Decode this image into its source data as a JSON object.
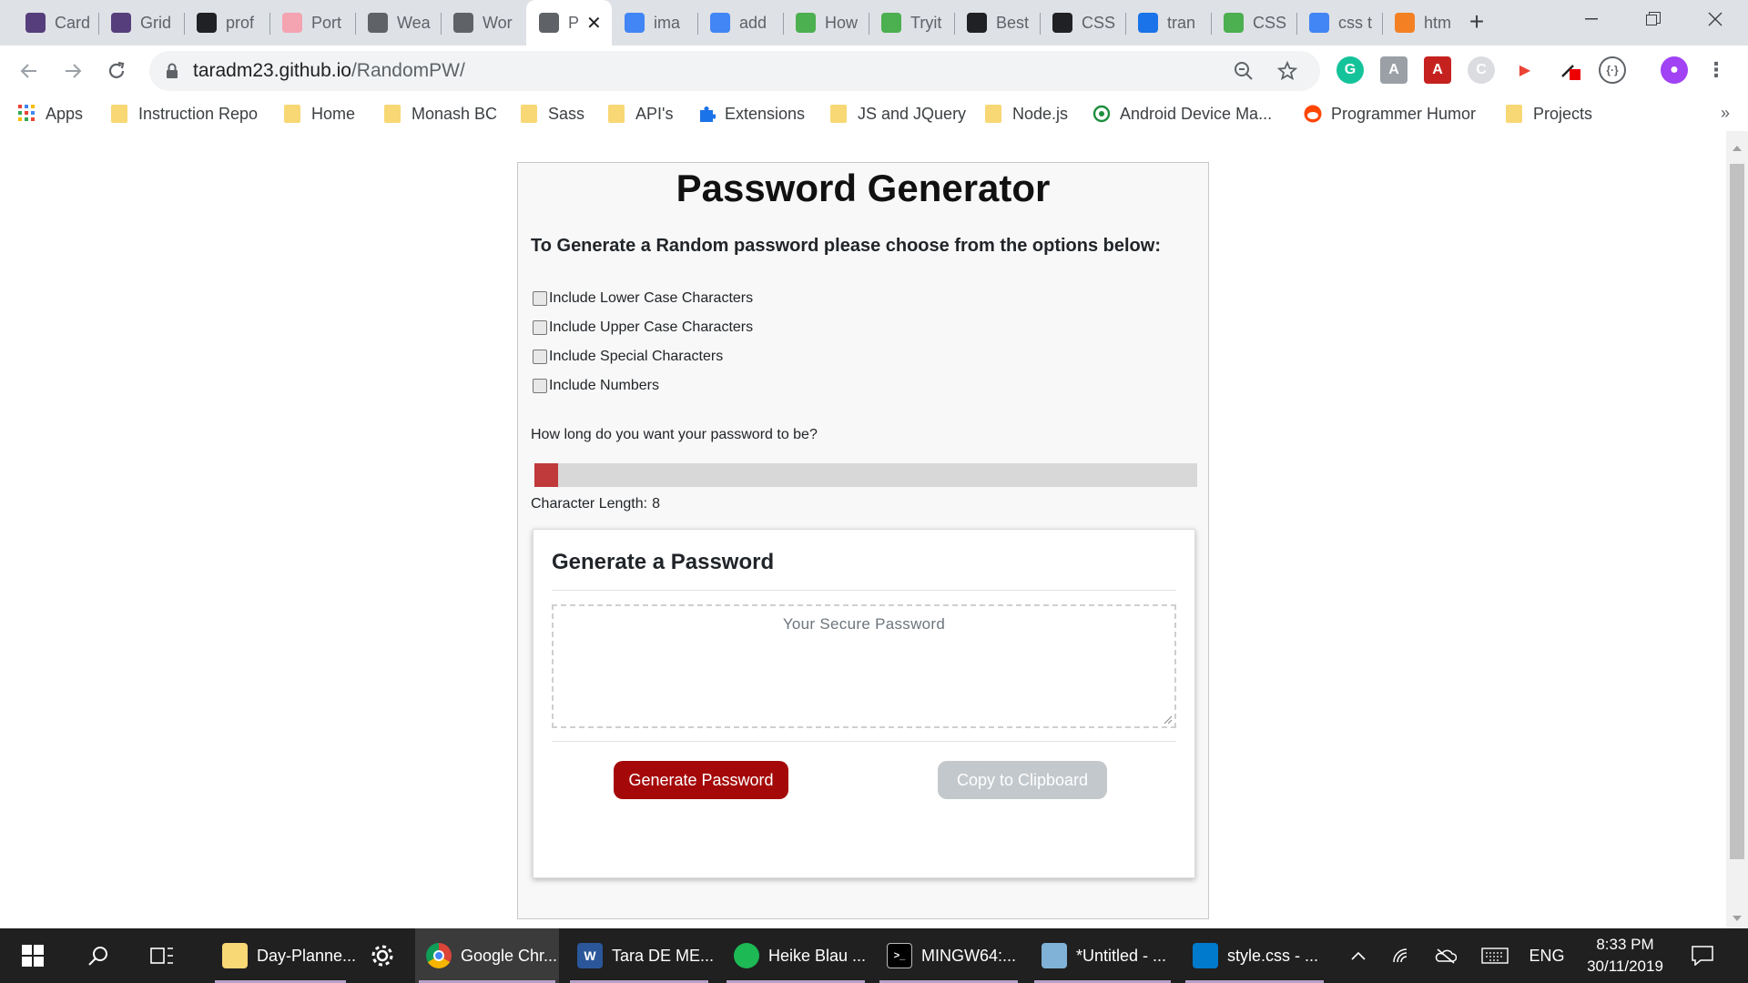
{
  "browser": {
    "tabs": [
      {
        "label": "Card",
        "icon": "bootstrap-icon",
        "color": "#563d7c"
      },
      {
        "label": "Grid",
        "icon": "bootstrap-icon",
        "color": "#563d7c"
      },
      {
        "label": "prof",
        "icon": "ch-icon",
        "color": "#202124"
      },
      {
        "label": "Port",
        "icon": "portfolio-icon",
        "color": "#f4a3b1"
      },
      {
        "label": "Wea",
        "icon": "globe-icon",
        "color": "#5f6368"
      },
      {
        "label": "Wor",
        "icon": "globe-icon",
        "color": "#5f6368"
      },
      {
        "label": "P",
        "icon": "globe-icon",
        "color": "#5f6368"
      },
      {
        "label": "ima",
        "icon": "google-icon",
        "color": "#4285f4"
      },
      {
        "label": "add",
        "icon": "google-icon",
        "color": "#4285f4"
      },
      {
        "label": "How",
        "icon": "w3schools-icon",
        "color": "#4caf50"
      },
      {
        "label": "Tryit",
        "icon": "w3schools-icon",
        "color": "#4caf50"
      },
      {
        "label": "Best",
        "icon": "jf-icon",
        "color": "#202124"
      },
      {
        "label": "CSS",
        "icon": "codepen-icon",
        "color": "#202124"
      },
      {
        "label": "tran",
        "icon": "graduation-icon",
        "color": "#1a73e8"
      },
      {
        "label": "CSS",
        "icon": "w3schools-icon",
        "color": "#4caf50"
      },
      {
        "label": "css t",
        "icon": "google-icon",
        "color": "#4285f4"
      },
      {
        "label": "htm",
        "icon": "stackoverflow-icon",
        "color": "#f48024"
      }
    ],
    "address": {
      "domain": "taradm23.github.io",
      "path": "/RandomPW/"
    },
    "bookmarks": [
      {
        "label": "Apps",
        "type": "apps"
      },
      {
        "label": "Instruction Repo",
        "type": "folder"
      },
      {
        "label": "Home",
        "type": "folder"
      },
      {
        "label": "Monash BC",
        "type": "folder"
      },
      {
        "label": "Sass",
        "type": "folder"
      },
      {
        "label": "API's",
        "type": "folder"
      },
      {
        "label": "Extensions",
        "type": "puzzle"
      },
      {
        "label": "JS and JQuery",
        "type": "folder"
      },
      {
        "label": "Node.js",
        "type": "folder"
      },
      {
        "label": "Android Device Ma...",
        "type": "android"
      },
      {
        "label": "Programmer Humor",
        "type": "reddit"
      },
      {
        "label": "Projects",
        "type": "folder"
      }
    ],
    "bookmarks_more": "»"
  },
  "page": {
    "title": "Password Generator",
    "subtitle": "To Generate a Random password please choose from the options below:",
    "options": [
      {
        "label": "Include Lower Case Characters",
        "checked": false
      },
      {
        "label": "Include Upper Case Characters",
        "checked": false
      },
      {
        "label": "Include Special Characters",
        "checked": false
      },
      {
        "label": "Include Numbers",
        "checked": false
      }
    ],
    "length_question": "How long do you want your password to be?",
    "length_label": "Character Length:",
    "length_value": "8",
    "slider_fraction": 0.0,
    "card": {
      "title": "Generate a Password",
      "placeholder": "Your Secure Password",
      "generate_label": "Generate Password",
      "copy_label": "Copy to Clipboard"
    },
    "colors": {
      "accent": "#a50808",
      "slider_thumb": "#c0393b",
      "copy_disabled": "#c3c8cc"
    }
  },
  "taskbar": {
    "apps": [
      {
        "label": "Day-Planne...",
        "icon": "folder-icon",
        "color": "#f8d775"
      },
      {
        "label": "Google Chr...",
        "icon": "chrome-icon",
        "color": "#4285f4",
        "active": true
      },
      {
        "label": "Tara DE ME...",
        "icon": "word-icon",
        "color": "#2b579a"
      },
      {
        "label": "Heike Blau ...",
        "icon": "spotify-icon",
        "color": "#1db954"
      },
      {
        "label": "MINGW64:...",
        "icon": "terminal-icon",
        "color": "#000000"
      },
      {
        "label": "*Untitled - ...",
        "icon": "notepad-icon",
        "color": "#7fb2d6"
      },
      {
        "label": "style.css - ...",
        "icon": "vscode-icon",
        "color": "#007acc"
      }
    ],
    "language": "ENG",
    "time": "8:33 PM",
    "date": "30/11/2019"
  }
}
